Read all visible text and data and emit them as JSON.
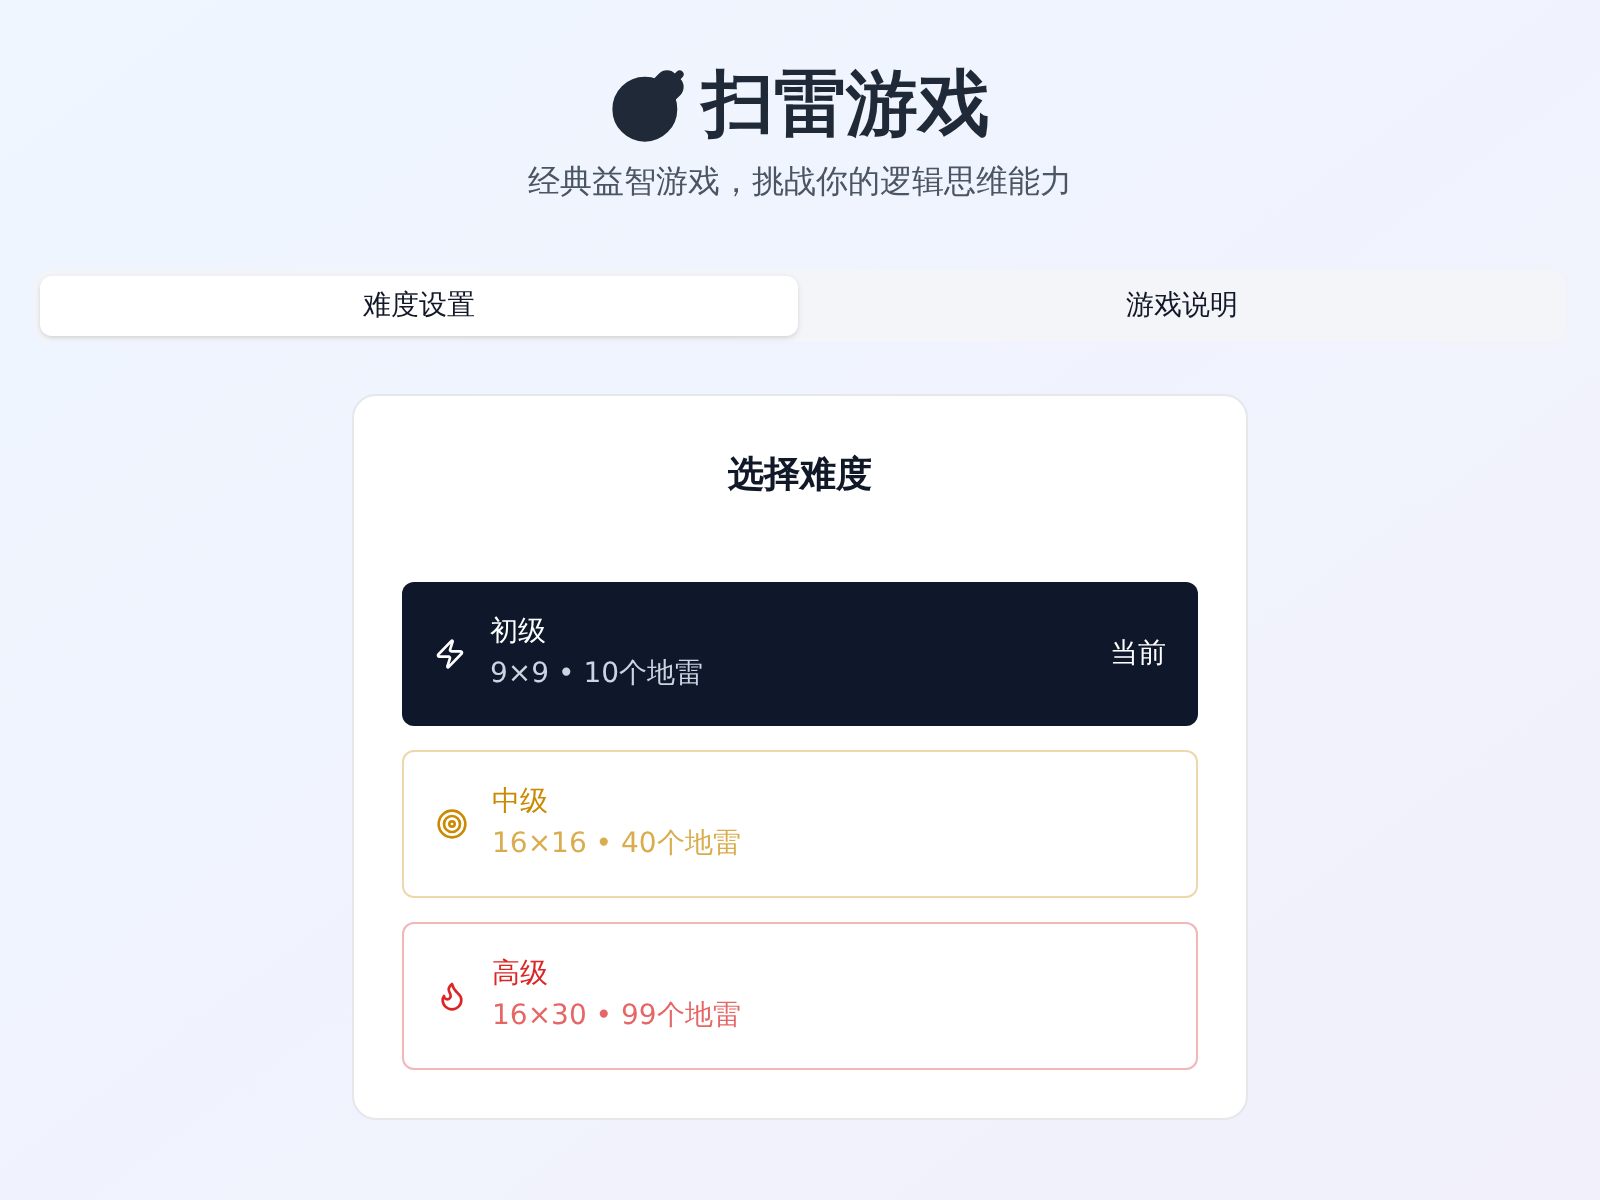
{
  "header": {
    "title": "扫雷游戏",
    "subtitle": "经典益智游戏，挑战你的逻辑思维能力"
  },
  "tabs": [
    {
      "label": "难度设置",
      "selected": true
    },
    {
      "label": "游戏说明",
      "selected": false
    }
  ],
  "card": {
    "title": "选择难度",
    "current_label": "当前",
    "levels": [
      {
        "kind": "easy",
        "name": "初级",
        "detail": "9×9 • 10个地雷",
        "color": "#0f172a",
        "selected": true
      },
      {
        "kind": "medium",
        "name": "中级",
        "detail": "16×16 • 40个地雷",
        "color": "#ca8a04",
        "selected": false
      },
      {
        "kind": "hard",
        "name": "高级",
        "detail": "16×30 • 99个地雷",
        "color": "#dc2626",
        "selected": false
      }
    ]
  }
}
